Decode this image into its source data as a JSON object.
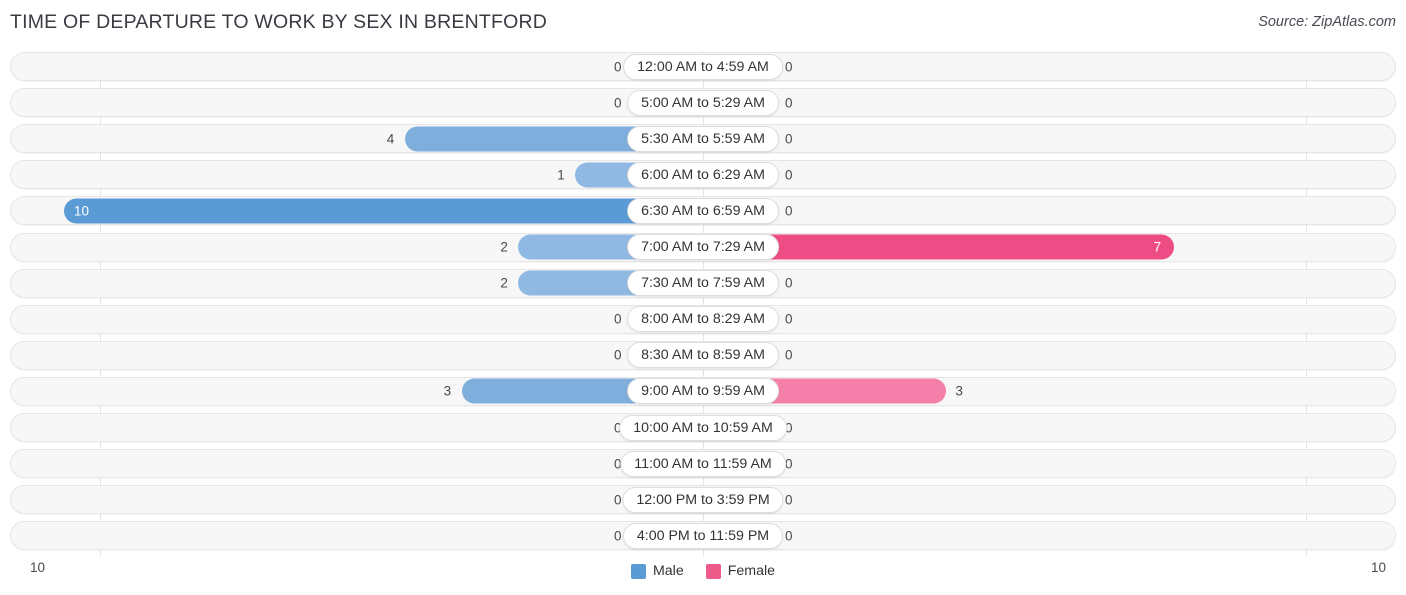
{
  "header": {
    "title": "TIME OF DEPARTURE TO WORK BY SEX IN BRENTFORD",
    "source": "Source: ZipAtlas.com"
  },
  "legend": {
    "male_label": "Male",
    "female_label": "Female",
    "male_color": "#5B9BD5",
    "female_color": "#EE5A8A"
  },
  "axis": {
    "left_label": "10",
    "right_label": "10",
    "max": 10
  },
  "colors": {
    "male_zero": "#A8C6E8",
    "male_low": "#8FB8E2",
    "male_mid": "#7FAEDC",
    "male_high": "#5B9BD5",
    "female_zero": "#F49AC1",
    "female_mid": "#F47FA8",
    "female_high": "#EE4C84",
    "row_bg": "#f7f7f7",
    "row_border": "#e6e6e6",
    "gridline": "#e4e4e4"
  },
  "chart_data": {
    "type": "bar",
    "orientation": "horizontal-diverging",
    "title": "TIME OF DEPARTURE TO WORK BY SEX IN BRENTFORD",
    "xlabel": "",
    "ylabel": "",
    "xlim": [
      10,
      10
    ],
    "grid": true,
    "legend_position": "bottom-center",
    "categories": [
      "12:00 AM to 4:59 AM",
      "5:00 AM to 5:29 AM",
      "5:30 AM to 5:59 AM",
      "6:00 AM to 6:29 AM",
      "6:30 AM to 6:59 AM",
      "7:00 AM to 7:29 AM",
      "7:30 AM to 7:59 AM",
      "8:00 AM to 8:29 AM",
      "8:30 AM to 8:59 AM",
      "9:00 AM to 9:59 AM",
      "10:00 AM to 10:59 AM",
      "11:00 AM to 11:59 AM",
      "12:00 PM to 3:59 PM",
      "4:00 PM to 11:59 PM"
    ],
    "series": [
      {
        "name": "Male",
        "values": [
          0,
          0,
          4,
          1,
          10,
          2,
          2,
          0,
          0,
          3,
          0,
          0,
          0,
          0
        ],
        "labels": [
          "0",
          "0",
          "4",
          "1",
          "10",
          "2",
          "2",
          "0",
          "0",
          "3",
          "0",
          "0",
          "0",
          "0"
        ]
      },
      {
        "name": "Female",
        "values": [
          0,
          0,
          0,
          0,
          0,
          7,
          0,
          0,
          0,
          3,
          0,
          0,
          0,
          0
        ],
        "labels": [
          "0",
          "0",
          "0",
          "0",
          "0",
          "7",
          "0",
          "0",
          "0",
          "3",
          "0",
          "0",
          "0",
          "0"
        ]
      }
    ]
  }
}
